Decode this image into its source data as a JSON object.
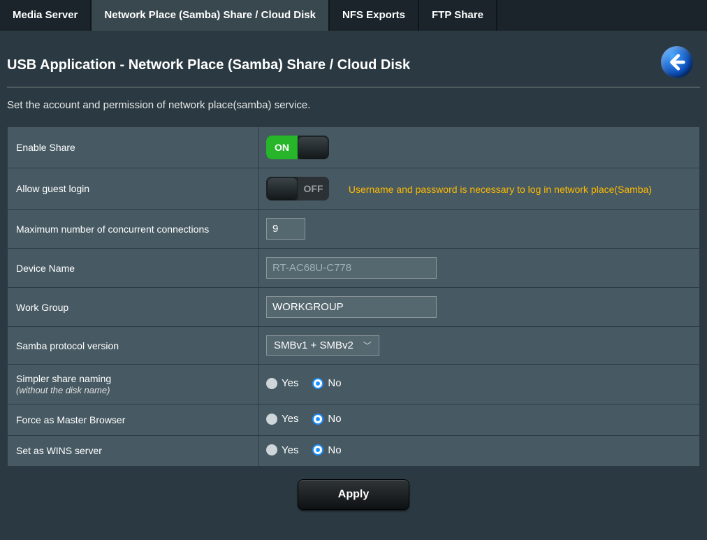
{
  "tabs": {
    "media_server": "Media Server",
    "samba": "Network Place (Samba) Share / Cloud Disk",
    "nfs": "NFS Exports",
    "ftp": "FTP Share",
    "active": "samba"
  },
  "page": {
    "title": "USB Application - Network Place (Samba) Share / Cloud Disk",
    "description": "Set the account and permission of network place(samba) service."
  },
  "fields": {
    "enable_share": {
      "label": "Enable Share",
      "value": "on",
      "on_text": "ON",
      "off_text": "OFF"
    },
    "allow_guest": {
      "label": "Allow guest login",
      "value": "off",
      "on_text": "ON",
      "off_text": "OFF",
      "hint": "Username and password is necessary to log in network place(Samba)"
    },
    "max_conn": {
      "label": "Maximum number of concurrent connections",
      "value": "9"
    },
    "device_name": {
      "label": "Device Name",
      "value": "RT-AC68U-C778"
    },
    "workgroup": {
      "label": "Work Group",
      "value": "WORKGROUP"
    },
    "smb_version": {
      "label": "Samba protocol version",
      "value": "SMBv1 + SMBv2"
    },
    "simpler_name": {
      "label": "Simpler share naming",
      "sublabel": "(without the disk name)",
      "yes": "Yes",
      "no": "No",
      "value": "no"
    },
    "master_browser": {
      "label": "Force as Master Browser",
      "yes": "Yes",
      "no": "No",
      "value": "no"
    },
    "wins_server": {
      "label": "Set as WINS server",
      "yes": "Yes",
      "no": "No",
      "value": "no"
    }
  },
  "buttons": {
    "apply": "Apply"
  }
}
